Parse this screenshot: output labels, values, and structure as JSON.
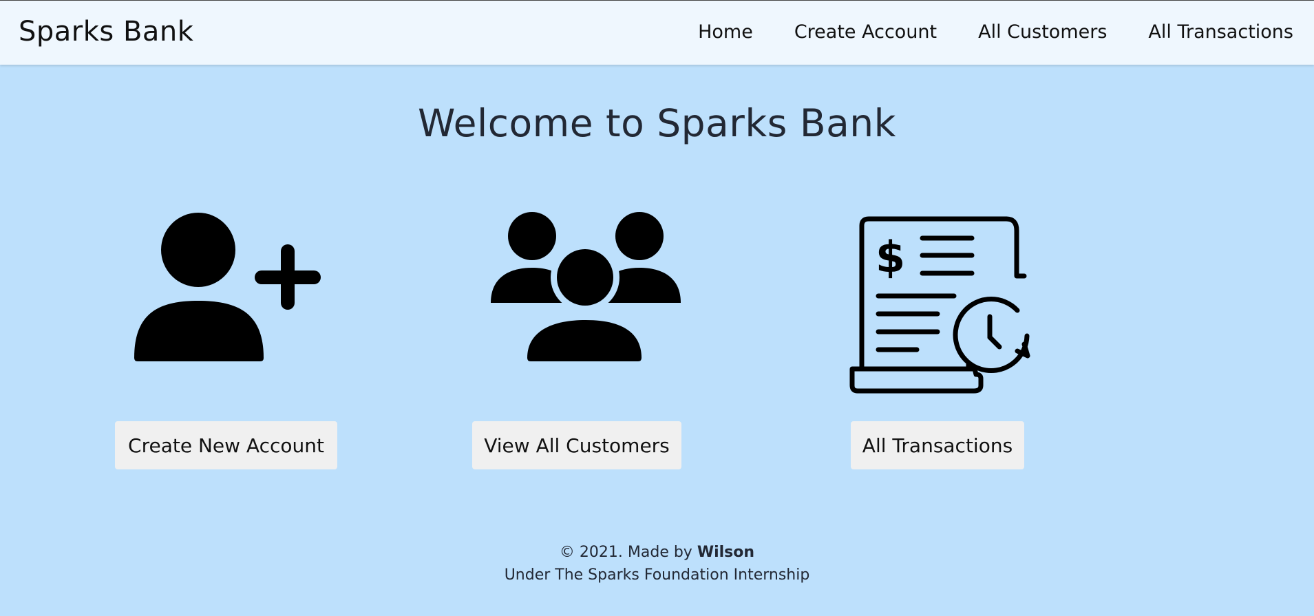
{
  "navbar": {
    "brand": "Sparks Bank",
    "links": [
      "Home",
      "Create Account",
      "All Customers",
      "All Transactions"
    ]
  },
  "main": {
    "heading": "Welcome to Sparks Bank",
    "cards": [
      {
        "icon": "add-user-icon",
        "button": "Create New Account"
      },
      {
        "icon": "users-group-icon",
        "button": "View All Customers"
      },
      {
        "icon": "transaction-receipt-icon",
        "button": "All Transactions"
      }
    ]
  },
  "footer": {
    "prefix": "© 2021. Made by ",
    "author": "Wilson",
    "line2": "Under The Sparks Foundation Internship"
  },
  "colors": {
    "page_background": "#bde0fc",
    "navbar_background": "#eff7fe",
    "button_background": "#f0f0f0"
  }
}
